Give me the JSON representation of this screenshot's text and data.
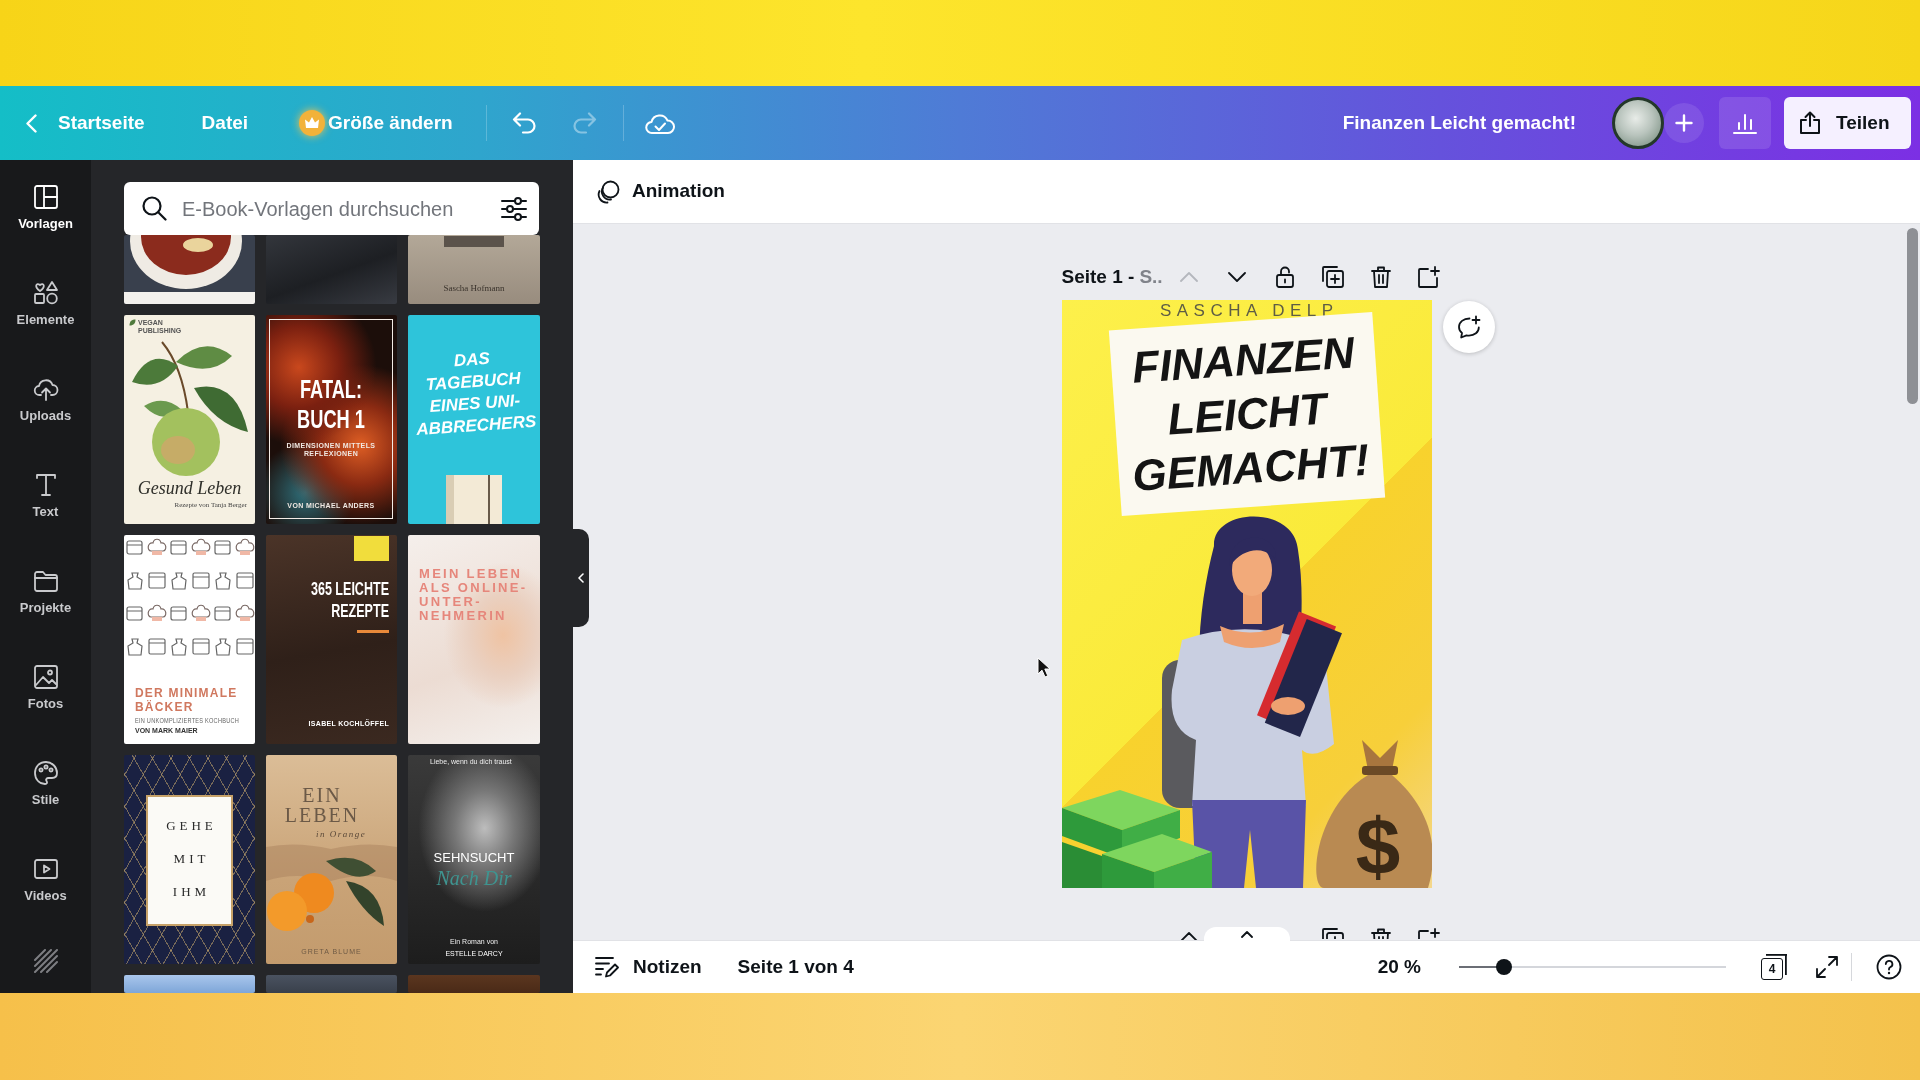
{
  "top_bar": {
    "home": "Startseite",
    "menu": "Datei",
    "resize": "Größe ändern",
    "undo": {
      "disabled": false
    },
    "redo": {
      "disabled": true
    },
    "title": "Finanzen Leicht gemacht!",
    "share": "Teilen"
  },
  "sidebar": {
    "items": [
      {
        "label": "Vorlagen",
        "selected": true
      },
      {
        "label": "Elemente",
        "selected": false
      },
      {
        "label": "Uploads",
        "selected": false
      },
      {
        "label": "Text",
        "selected": false
      },
      {
        "label": "Projekte",
        "selected": false
      },
      {
        "label": "Fotos",
        "selected": false
      },
      {
        "label": "Stile",
        "selected": false
      },
      {
        "label": "Videos",
        "selected": false
      }
    ]
  },
  "template_panel": {
    "search": {
      "placeholder": "E-Book-Vorlagen durchsuchen"
    },
    "rows": [
      [
        {
          "kind": "soup"
        },
        {
          "kind": "dark"
        },
        {
          "kind": "beige",
          "lines": [
            "Sascha Hofmann"
          ]
        }
      ],
      [
        {
          "kind": "apple",
          "lines": [
            "VEGAN PUBLISHING",
            "Gesund Leben",
            "Rezepte von Tanja Berger"
          ]
        },
        {
          "kind": "marble",
          "lines": [
            "FATAL: BUCH 1",
            "DIMENSIONEN MITTELS REFLEXIONEN",
            "VON MICHAEL ANDERS"
          ]
        },
        {
          "kind": "notebook",
          "lines": [
            "DAS TAGEBUCH EINES UNI-ABBRECHERS"
          ]
        }
      ],
      [
        {
          "kind": "bakery",
          "lines": [
            "DER MINIMALE BÄCKER",
            "EIN UNKOMPLIZIERTES KOCHBUCH",
            "VON MARK MAIER"
          ]
        },
        {
          "kind": "food",
          "lines": [
            "365 LEICHTE REZEPTE",
            "ISABEL KOCHLÖFFEL"
          ]
        },
        {
          "kind": "portrait",
          "lines": [
            "MEIN LEBEN ALS ONLINE-UNTER-NEHMERIN"
          ]
        }
      ],
      [
        {
          "kind": "frame",
          "lines": [
            "GEHE",
            "MIT",
            "IHM"
          ]
        },
        {
          "kind": "oranges",
          "lines": [
            "EIN LEBEN",
            "in Orange",
            "GRETA BLUME"
          ]
        },
        {
          "kind": "couple",
          "lines": [
            "Liebe, wenn du dich traust",
            "SEHNSUCHT",
            "Nach Dir",
            "Ein Roman von",
            "ESTELLE DARCY"
          ]
        }
      ],
      [
        {
          "kind": "sky"
        },
        {
          "kind": "slate"
        },
        {
          "kind": "brown"
        }
      ]
    ]
  },
  "toolbar": {
    "animation": "Animation"
  },
  "page": {
    "label": "Seite 1 -",
    "title": "S..",
    "move_up": {
      "disabled": true
    },
    "cover": {
      "author": "SASCHA DELP",
      "title": "FINANZEN LEICHT GEMACHT!",
      "bag_symbol": "$"
    }
  },
  "bottom_bar": {
    "notes": "Notizen",
    "page_info": "Seite 1 von 4",
    "zoom": {
      "reading": "20 %",
      "level": 0.17
    },
    "page_count": "4"
  }
}
